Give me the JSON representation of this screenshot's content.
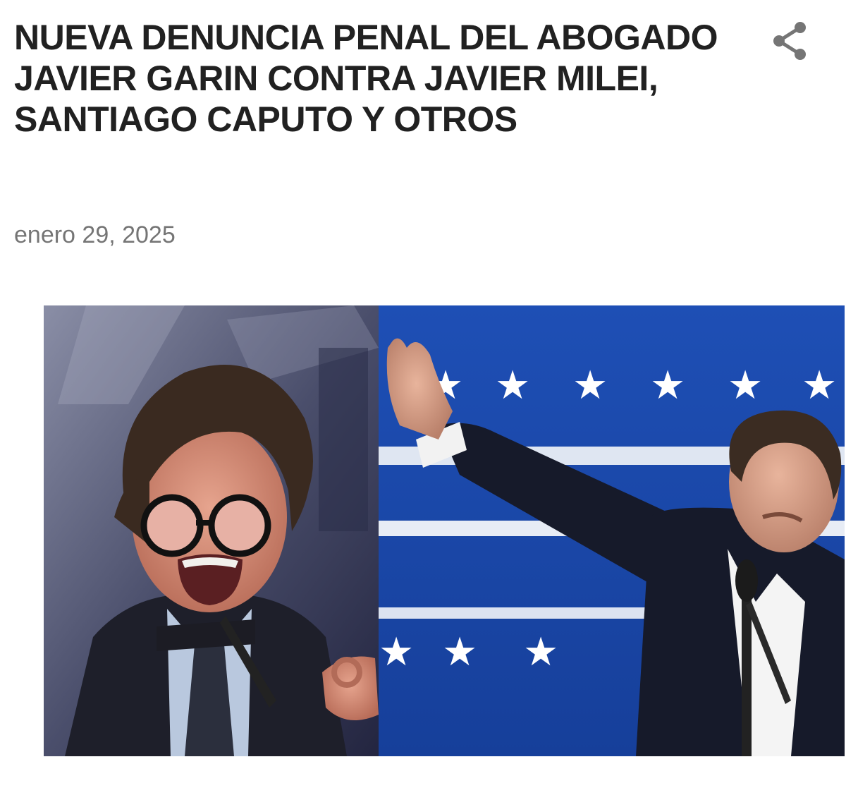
{
  "post": {
    "title": "NUEVA DENUNCIA PENAL DEL ABOGADO JAVIER GARIN CONTRA JAVIER MILEI, SANTIAGO CAPUTO Y OTROS",
    "date": "enero 29, 2025"
  },
  "toolbar": {
    "share_icon": "share-icon"
  },
  "colors": {
    "title": "#212121",
    "date": "#757575",
    "icon": "#757575",
    "background": "#ffffff"
  }
}
